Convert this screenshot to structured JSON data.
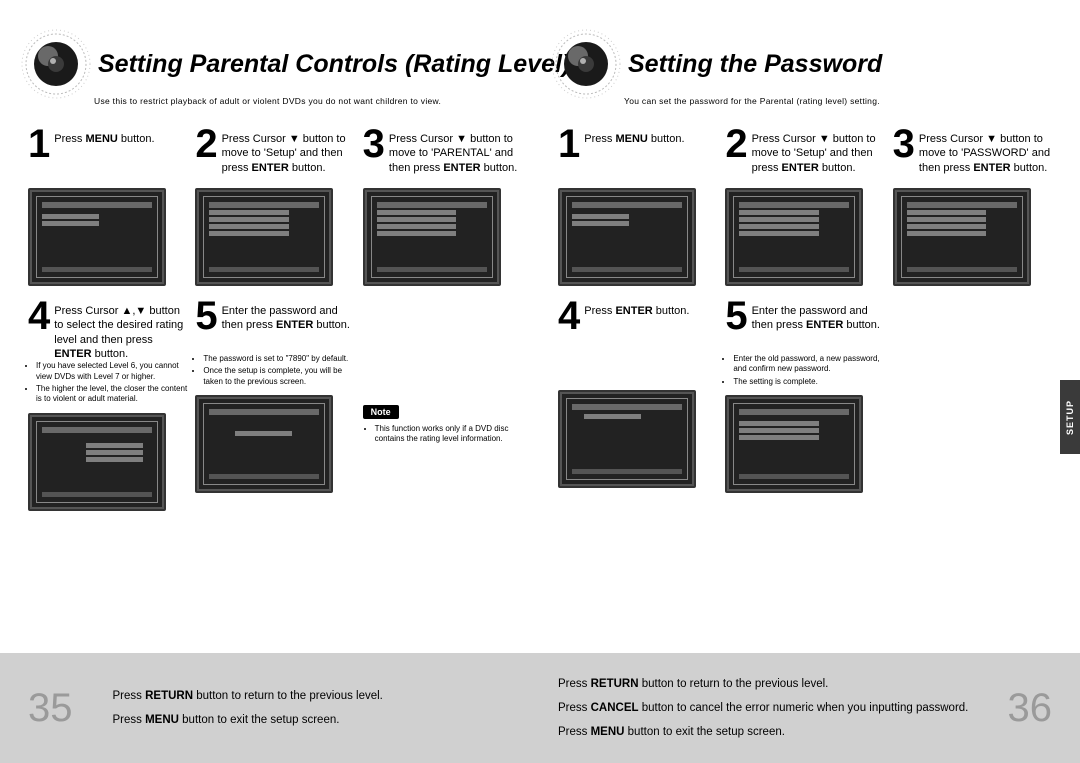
{
  "left": {
    "title": "Setting Parental Controls (Rating Level)",
    "subtitle": "Use this to restrict playback of adult or violent DVDs you do not want children to view.",
    "steps_top": [
      {
        "num": "1",
        "html": "Press <b>MENU</b>  button."
      },
      {
        "num": "2",
        "html": "Press Cursor ▼ button to move to 'Setup' and then press <b>ENTER</b> button."
      },
      {
        "num": "3",
        "html": "Press Cursor ▼ button to move to 'PARENTAL' and then press <b>ENTER</b> button."
      }
    ],
    "steps_bottom": [
      {
        "num": "4",
        "html": "Press Cursor ▲,▼ button to select the desired rating level and then press <b>ENTER</b> button."
      },
      {
        "num": "5",
        "html": "Enter the password and then press <b>ENTER</b> button."
      }
    ],
    "bullets4": [
      "If you have selected Level 6, you cannot view DVDs with Level 7 or higher.",
      "The higher the level, the closer the content is to violent or adult material."
    ],
    "bullets5": [
      "The password is set to \"7890\" by default.",
      "Once the setup is complete, you will be taken to the previous screen."
    ],
    "note_label": "Note",
    "note_items": [
      "This function works only if a DVD disc contains the rating level information."
    ],
    "footer_lines": [
      "Press <b>RETURN</b> button to return to the previous level.",
      "Press <b>MENU</b> button to exit the setup screen."
    ],
    "page_num": "35"
  },
  "right": {
    "title": "Setting the Password",
    "subtitle": "You can set the password for the Parental (rating level) setting.",
    "steps_top": [
      {
        "num": "1",
        "html": "Press <b>MENU</b> button."
      },
      {
        "num": "2",
        "html": "Press Cursor ▼ button to move to 'Setup' and then press <b>ENTER</b> button."
      },
      {
        "num": "3",
        "html": "Press Cursor ▼ button to move to 'PASSWORD' and then press <b>ENTER</b> button."
      }
    ],
    "steps_bottom": [
      {
        "num": "4",
        "html": "Press <b>ENTER</b> button."
      },
      {
        "num": "5",
        "html": "Enter the password and then press <b>ENTER</b> button."
      }
    ],
    "bullets5": [
      "Enter the old password, a new password, and confirm new password.",
      "The setting is complete."
    ],
    "footer_lines": [
      "Press <b>RETURN</b> button to return to the previous level.",
      "Press <b>CANCEL</b> button to cancel the error numeric when you inputting password.",
      "Press <b>MENU</b> button to exit the setup screen."
    ],
    "page_num": "36",
    "side_tab": "SETUP"
  }
}
